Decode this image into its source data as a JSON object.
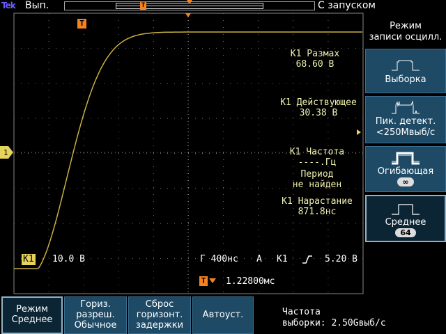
{
  "top": {
    "logo": "Tek",
    "acq_status": "Вып.",
    "trigger_status": "С запуском",
    "trigger_marker": "T"
  },
  "menu": {
    "title": "Режим\nзаписи осцилл.",
    "items": [
      {
        "label": "Выборка",
        "sub": ""
      },
      {
        "label": "Пик. детект.\n<250Мвыб/с",
        "sub": ""
      },
      {
        "label": "Огибающая",
        "badge": "∞"
      },
      {
        "label": "Среднее",
        "badge": "64",
        "selected": true
      }
    ]
  },
  "measurements": [
    {
      "title": "К1 Размах",
      "value": "68.60 В"
    },
    {
      "title": "К1 Действующее",
      "value": "30.38 В"
    },
    {
      "title": "К1 Частота",
      "value": "----.Гц"
    },
    {
      "title": "Период",
      "value": "не найден"
    },
    {
      "title": "К1 Нарастание",
      "value": "871.8нс"
    }
  ],
  "readout": {
    "channel": "К1",
    "volts_div": "10.0 В",
    "timebase": "Г 400нс",
    "trig_mode": "A",
    "trig_src": "К1",
    "trig_level": "5.20 В",
    "trig_delay": "1.22800мс",
    "trig_icon": "rising-edge-icon"
  },
  "waveform": {
    "color": "#c8b040",
    "channel_marker": "1"
  },
  "bottom": {
    "buttons": [
      {
        "label": "Режим\nСреднее",
        "selected": true
      },
      {
        "label": "Гориз.\nразреш.\nОбычное"
      },
      {
        "label": "Сброс\nгоризонт.\nзадержки"
      },
      {
        "label": "Автоуст."
      }
    ],
    "sample_rate_label": "Частота",
    "sample_rate_value": "выборки:  2.50Gвыб/с"
  },
  "colors": {
    "accent": "#f58220",
    "menu_bg": "#1e4a66",
    "channel1": "#e6d35a",
    "grid": "#888888"
  }
}
